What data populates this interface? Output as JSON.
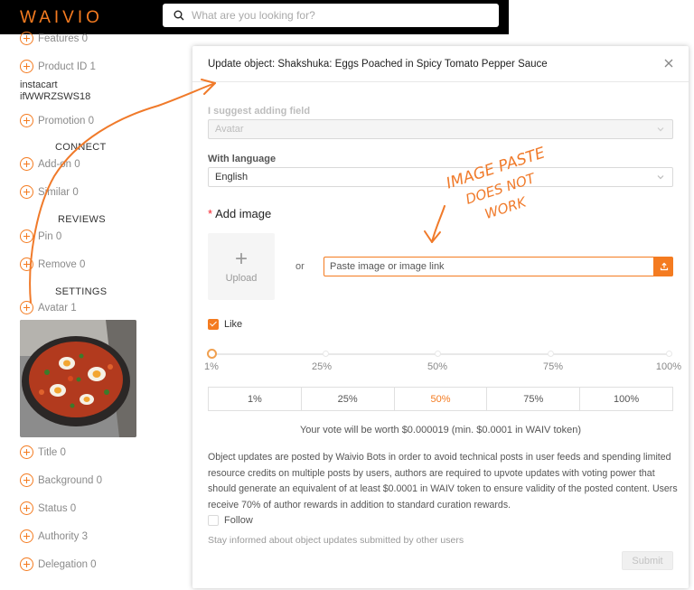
{
  "header": {
    "logo": "WAIVIO",
    "search_placeholder": "What are you looking for?"
  },
  "sidebar": {
    "items": [
      {
        "label": "Features 0"
      },
      {
        "label": "Product ID 1"
      },
      {
        "label": "Promotion 0"
      },
      {
        "label": "Add-on 0"
      },
      {
        "label": "Similar 0"
      },
      {
        "label": "Pin 0"
      },
      {
        "label": "Remove 0"
      },
      {
        "label": "Avatar 1"
      },
      {
        "label": "Title 0"
      },
      {
        "label": "Background 0"
      },
      {
        "label": "Status 0"
      },
      {
        "label": "Authority 3"
      },
      {
        "label": "Delegation 0"
      }
    ],
    "product_id_line1": "instacart",
    "product_id_line2": "ifWWRZSWS18",
    "headings": {
      "connect": "CONNECT",
      "reviews": "REVIEWS",
      "settings": "SETTINGS"
    }
  },
  "annotation": {
    "line1": "IMAGE PASTE",
    "line2": "DOES NOT",
    "line3": "WORK"
  },
  "modal": {
    "title": "Update object: Shakshuka: Eggs Poached in Spicy Tomato Pepper Sauce",
    "suggest_label": "I suggest adding field",
    "suggest_value": "Avatar",
    "language_label": "With language",
    "language_value": "English",
    "add_image_label": "Add image",
    "upload_label": "Upload",
    "or_text": "or",
    "paste_placeholder": "Paste image or image link",
    "like_label": "Like",
    "slider_value_percent": 1,
    "slider_marks": [
      "1%",
      "25%",
      "50%",
      "75%",
      "100%"
    ],
    "percent_buttons": [
      "1%",
      "25%",
      "50%",
      "75%",
      "100%"
    ],
    "active_percent_button": "50%",
    "vote_worth": "Your vote will be worth $0.000019 (min. $0.0001 in WAIV token)",
    "info_paragraph": "Object updates are posted by Waivio Bots in order to avoid technical posts in user feeds and spending limited resource credits on multiple posts by users, authors are required to upvote updates with voting power that should generate an equivalent of at least $0.0001 in WAIV token to ensure validity of the posted content. Users receive 70% of author rewards in addition to standard curation rewards.",
    "follow_label": "Follow",
    "stay_informed": "Stay informed about object updates submitted by other users",
    "submit_label": "Submit"
  },
  "colors": {
    "accent": "#f47b20",
    "header_bg": "#000000"
  }
}
